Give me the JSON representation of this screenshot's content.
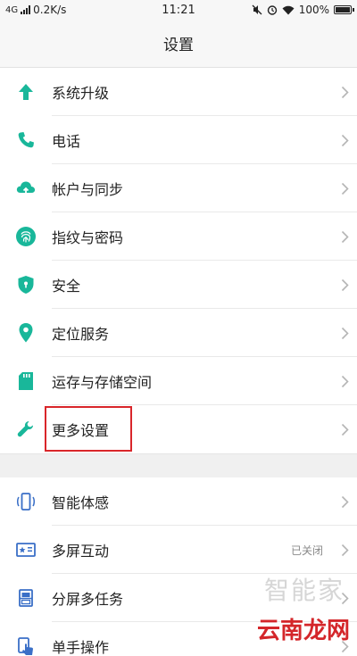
{
  "status_bar": {
    "network": "4G",
    "speed": "0.2K/s",
    "time": "11:21",
    "battery": "100%"
  },
  "header": {
    "title": "设置"
  },
  "colors": {
    "accent": "#19b79a",
    "highlight": "#d9262a",
    "divider": "#e9e9e9"
  },
  "group1": [
    {
      "label": "系统升级",
      "icon": "arrow-up-icon"
    },
    {
      "label": "电话",
      "icon": "phone-icon"
    },
    {
      "label": "帐户与同步",
      "icon": "cloud-sync-icon"
    },
    {
      "label": "指纹与密码",
      "icon": "fingerprint-icon"
    },
    {
      "label": "安全",
      "icon": "shield-icon"
    },
    {
      "label": "定位服务",
      "icon": "location-pin-icon"
    },
    {
      "label": "运存与存储空间",
      "icon": "sd-card-icon"
    },
    {
      "label": "更多设置",
      "icon": "wrench-icon"
    }
  ],
  "group2": [
    {
      "label": "智能体感",
      "icon": "motion-phone-icon",
      "value": ""
    },
    {
      "label": "多屏互动",
      "icon": "multiscreen-icon",
      "value": "已关闭"
    },
    {
      "label": "分屏多任务",
      "icon": "split-screen-icon",
      "value": ""
    },
    {
      "label": "单手操作",
      "icon": "one-hand-icon",
      "value": ""
    }
  ],
  "watermark": {
    "faint": "智能家",
    "brand": "云南龙网"
  }
}
